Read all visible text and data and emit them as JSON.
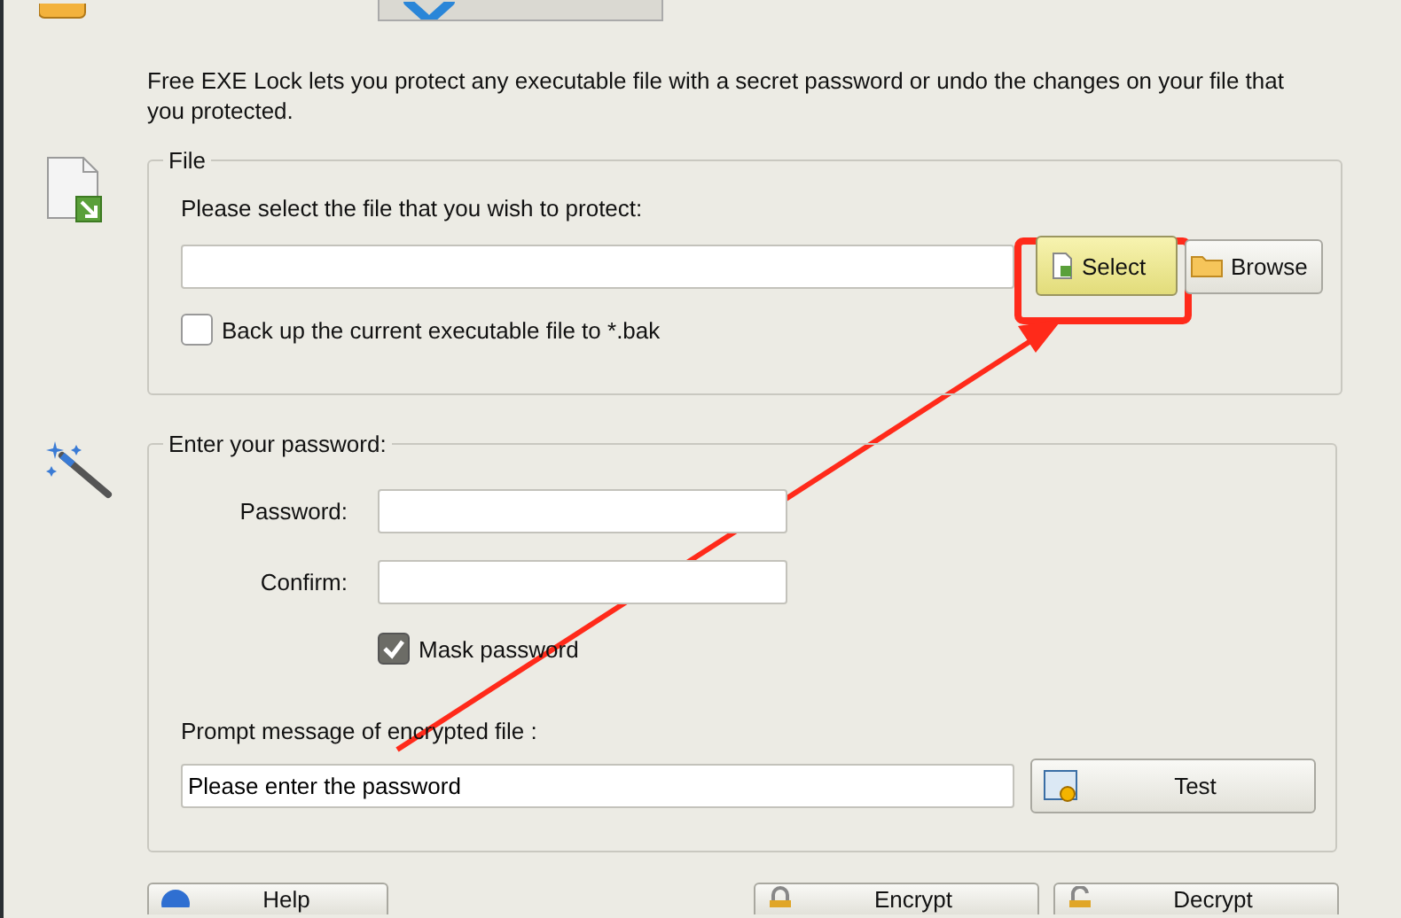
{
  "tabs": [
    {
      "selected": true
    },
    {
      "selected": false
    }
  ],
  "description": "Free EXE Lock lets you protect any executable file with a secret password or undo the changes on your file that you protected.",
  "file_group": {
    "title": "File",
    "prompt": "Please select the file that you wish to protect:",
    "buttons": [
      {
        "label": "Select",
        "kind": "select",
        "highlighted": true
      },
      {
        "label": "Browse",
        "kind": "browse",
        "highlighted": false
      }
    ],
    "backup": {
      "label": "Back up the current executable file to *.bak",
      "checked": false
    }
  },
  "password_group": {
    "title": "Enter your password:",
    "fields": [
      {
        "label": "Password:"
      },
      {
        "label": "Confirm:"
      }
    ],
    "mask": {
      "label": "Mask password",
      "checked": true
    },
    "prompt_label": "Prompt message of encrypted file :",
    "prompt_value": "Please enter the password",
    "test_button": "Test"
  },
  "bottom_buttons": [
    {
      "label": "Help",
      "kind": "help"
    },
    {
      "label": "Encrypt",
      "kind": "encrypt"
    },
    {
      "label": "Decrypt",
      "kind": "decrypt"
    }
  ]
}
